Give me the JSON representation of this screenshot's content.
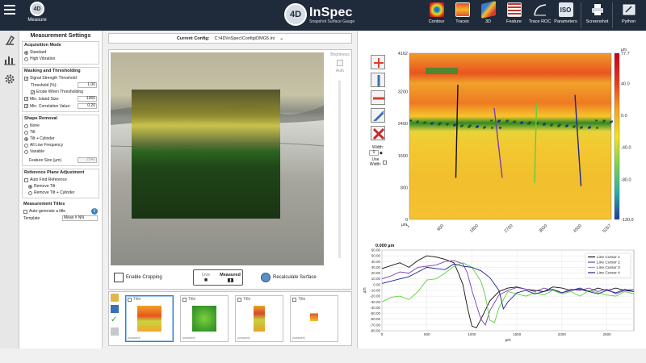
{
  "toolbar": {
    "measure_label": "Measure",
    "brand_mark": "4D",
    "brand_name": "InSpec",
    "brand_sub": "Snapshot Surface Gauge",
    "buttons": [
      {
        "label": "Contour",
        "icon": "contour-icon",
        "color": "#e25a24"
      },
      {
        "label": "Traces",
        "icon": "traces-icon",
        "color": "#e07b2a"
      },
      {
        "label": "3D",
        "icon": "3d-icon",
        "color": "#d23f5f"
      },
      {
        "label": "Feature",
        "icon": "feature-icon",
        "color": "#c0392b"
      },
      {
        "label": "Trace ROC",
        "icon": "trace-roc-icon",
        "color": "#dfe6ee"
      },
      {
        "label": "Parameters",
        "icon": "parameters-icon",
        "color": "#dfe6ee"
      },
      {
        "label": "Screenshot",
        "icon": "printer-icon",
        "color": "#dfe6ee"
      },
      {
        "label": "Python",
        "icon": "python-icon",
        "color": "#dfe6ee"
      }
    ]
  },
  "settings": {
    "title": "Measurement Settings",
    "acquisition": {
      "title": "Acquisition Mode",
      "options": [
        {
          "label": "Standard",
          "selected": true
        },
        {
          "label": "High Vibration",
          "selected": false
        }
      ]
    },
    "masking": {
      "title": "Masking and Thresholding",
      "signal_strength": "Signal Strength Threshold",
      "threshold_label": "Threshold (%):",
      "threshold_value": "1.00",
      "erode": "Erode When Thresholding",
      "island_label": "Min. Island Size:",
      "island_value": "1360",
      "corr_label": "Min. Correlation Value:",
      "corr_value": "0.20"
    },
    "shape": {
      "title": "Shape Removal",
      "options": [
        {
          "label": "None",
          "selected": false
        },
        {
          "label": "Tilt",
          "selected": false
        },
        {
          "label": "Tilt + Cylinder",
          "selected": true
        },
        {
          "label": "All Low Frequency",
          "selected": false
        },
        {
          "label": "Variable",
          "selected": false
        }
      ],
      "feature_label": "Feature Size (µm)",
      "feature_value": "2540"
    },
    "reference": {
      "title": "Reference Plane Adjustment",
      "auto_find": "Auto Find Reference",
      "options": [
        {
          "label": "Remove Tilt",
          "selected": true
        },
        {
          "label": "Remove Tilt + Cylinder",
          "selected": false
        }
      ]
    },
    "titles": {
      "title": "Measurement Titles",
      "auto": "Auto-generate a title",
      "template_label": "Template",
      "template_value": "Meas # NN"
    }
  },
  "center": {
    "config_label": "Current Config:",
    "config_path": "C:\\4D\\InSpec\\Config\\DMG5.ini",
    "brightness_label": "Brightness",
    "auto_label": "Auto",
    "enable_cropping": "Enable Cropping",
    "live_label": "Live",
    "measured_label": "Measured",
    "recalc_label": "Recalculate Surface"
  },
  "gallery": {
    "items": [
      {
        "title": "Title",
        "caption": "(unsaved)",
        "selected": true
      },
      {
        "title": "Title",
        "caption": "(unsaved)",
        "selected": false
      },
      {
        "title": "Title",
        "caption": "(unsaved)",
        "selected": false
      },
      {
        "title": "Title",
        "caption": "(unsaved)",
        "selected": false
      }
    ]
  },
  "analysis": {
    "width_label": "Width:",
    "width_value": "0",
    "use_width_label": "Use Width:"
  },
  "chart_data": [
    {
      "type": "heatmap",
      "unit_label": "µm",
      "y_unit": "µm",
      "x_unit": "µm",
      "y_ticks": [
        "4162",
        "3200",
        "2400",
        "1600",
        "800",
        "0"
      ],
      "x_ticks": [
        "1",
        "900",
        "1800",
        "2700",
        "3600",
        "4500",
        "5267"
      ],
      "colorbar_ticks": [
        "77.7",
        "40.0",
        "0.0",
        "-40.0",
        "-80.0",
        "-130.0"
      ],
      "colorbar_colors": [
        "#c4001a",
        "#e8351c",
        "#f7a01c",
        "#f3e31a",
        "#7ed54a",
        "#2bb0a7",
        "#1e3c9c"
      ],
      "cursors": [
        {
          "name": "Line Cursor 1",
          "color": "#111111"
        },
        {
          "name": "Line Cursor 2",
          "color": "#7a3db0"
        },
        {
          "name": "Line Cursor 3",
          "color": "#5bd23a"
        },
        {
          "name": "Line Cursor 4",
          "color": "#1c2490"
        }
      ]
    },
    {
      "type": "line",
      "title": "0.000 µm",
      "xlabel": "µm",
      "ylabel": "µm",
      "xlim": [
        0,
        2800
      ],
      "ylim": [
        -80,
        60
      ],
      "x_ticks": [
        "0",
        "500",
        "1000",
        "1500",
        "2000",
        "2500"
      ],
      "y_ticks": [
        "60.00",
        "50.00",
        "40.00",
        "30.00",
        "20.00",
        "10.00",
        "0.00",
        "-10.00",
        "-20.00",
        "-30.00",
        "-40.00",
        "-50.00",
        "-60.00",
        "-70.00",
        "-80.00"
      ],
      "series": [
        {
          "name": "Line Cursor 1",
          "color": "#111111",
          "x": [
            0,
            100,
            200,
            300,
            400,
            500,
            600,
            700,
            800,
            850,
            900,
            950,
            1000,
            1050,
            1100,
            1200,
            1300,
            1400,
            1500,
            1600,
            1700,
            1800,
            1900,
            2000,
            2100,
            2200,
            2300,
            2400,
            2500,
            2600,
            2700,
            2800
          ],
          "y": [
            28,
            33,
            38,
            30,
            42,
            50,
            48,
            44,
            38,
            20,
            0,
            -40,
            -72,
            -75,
            -60,
            -28,
            -12,
            -6,
            -4,
            -8,
            -10,
            -12,
            -4,
            -6,
            -10,
            -8,
            -12,
            -6,
            -10,
            -6,
            -10,
            -12
          ]
        },
        {
          "name": "Line Cursor 2",
          "color": "#7a3db0",
          "x": [
            0,
            100,
            200,
            300,
            400,
            500,
            600,
            700,
            800,
            900,
            950,
            1000,
            1100,
            1150,
            1200,
            1300,
            1400,
            1500,
            1600,
            1700,
            1800,
            1900,
            2000,
            2100,
            2200,
            2300,
            2400,
            2500,
            2600,
            2700,
            2800
          ],
          "y": [
            10,
            15,
            22,
            20,
            30,
            32,
            34,
            40,
            42,
            36,
            20,
            -10,
            -60,
            -70,
            -45,
            -18,
            -10,
            -5,
            -8,
            -12,
            -6,
            -10,
            -14,
            -8,
            -10,
            -6,
            -12,
            -8,
            -16,
            -10,
            -8
          ]
        },
        {
          "name": "Line Cursor 3",
          "color": "#5bd23a",
          "x": [
            0,
            100,
            200,
            300,
            400,
            500,
            600,
            700,
            800,
            900,
            1000,
            1100,
            1150,
            1200,
            1250,
            1300,
            1400,
            1500,
            1600,
            1700,
            1800,
            1900,
            2000,
            2100,
            2200,
            2300,
            2400,
            2500,
            2600,
            2700,
            2800
          ],
          "y": [
            -30,
            -22,
            -20,
            -26,
            -12,
            8,
            10,
            20,
            32,
            38,
            30,
            6,
            -20,
            -62,
            -66,
            -40,
            -12,
            -16,
            -20,
            -14,
            -18,
            -10,
            -16,
            -12,
            -20,
            -10,
            -14,
            -18,
            -20,
            -12,
            -16
          ]
        },
        {
          "name": "Line Cursor 4",
          "color": "#1c2490",
          "x": [
            0,
            100,
            200,
            300,
            400,
            500,
            600,
            700,
            800,
            900,
            1000,
            1100,
            1200,
            1300,
            1350,
            1400,
            1500,
            1600,
            1700,
            1800,
            1900,
            2000,
            2100,
            2200,
            2300,
            2400,
            2500,
            2600,
            2700,
            2800
          ],
          "y": [
            2,
            6,
            10,
            14,
            22,
            30,
            28,
            26,
            36,
            32,
            30,
            24,
            12,
            -10,
            -42,
            -30,
            -14,
            -10,
            -16,
            -12,
            -8,
            -14,
            -10,
            -6,
            -12,
            -16,
            -10,
            -14,
            -8,
            -12
          ]
        }
      ]
    }
  ]
}
